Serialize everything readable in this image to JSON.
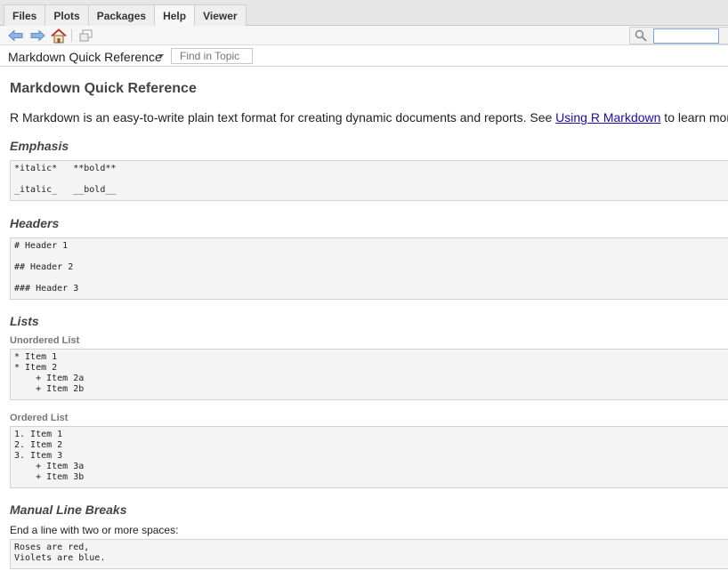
{
  "tabs": [
    {
      "label": "Files"
    },
    {
      "label": "Plots"
    },
    {
      "label": "Packages"
    },
    {
      "label": "Help"
    },
    {
      "label": "Viewer"
    }
  ],
  "active_tab": "Help",
  "toolbar": {
    "icons": [
      "back-arrow-icon",
      "forward-arrow-icon",
      "home-icon",
      "open-in-new-window-icon",
      "search-icon"
    ],
    "search_value": ""
  },
  "topic": {
    "title": "Markdown Quick Reference",
    "find_placeholder": "Find in Topic"
  },
  "doc": {
    "title": "Markdown Quick Reference",
    "intro_before": "R Markdown is an easy-to-write plain text format for creating dynamic documents and reports. See ",
    "intro_link": "Using R Markdown",
    "intro_after": " to learn more.",
    "emphasis": {
      "heading": "Emphasis",
      "lines": [
        "*italic*   **bold**",
        "_italic_   __bold__"
      ]
    },
    "headers": {
      "heading": "Headers",
      "lines": [
        "# Header 1",
        "## Header 2",
        "### Header 3"
      ]
    },
    "lists": {
      "heading": "Lists",
      "unordered_heading": "Unordered List",
      "unordered_lines": [
        "* Item 1",
        "* Item 2",
        "    + Item 2a",
        "    + Item 2b"
      ],
      "ordered_heading": "Ordered List",
      "ordered_lines": [
        "1. Item 1",
        "2. Item 2",
        "3. Item 3",
        "    + Item 3a",
        "    + Item 3b"
      ]
    },
    "line_breaks": {
      "heading": "Manual Line Breaks",
      "text": "End a line with two or more spaces:",
      "lines": [
        "Roses are red,",
        "Violets are blue."
      ]
    }
  },
  "colors": {
    "link": "#1a0dab",
    "arrow_blue": "#5b9bd5",
    "home_red": "#c0392b"
  }
}
